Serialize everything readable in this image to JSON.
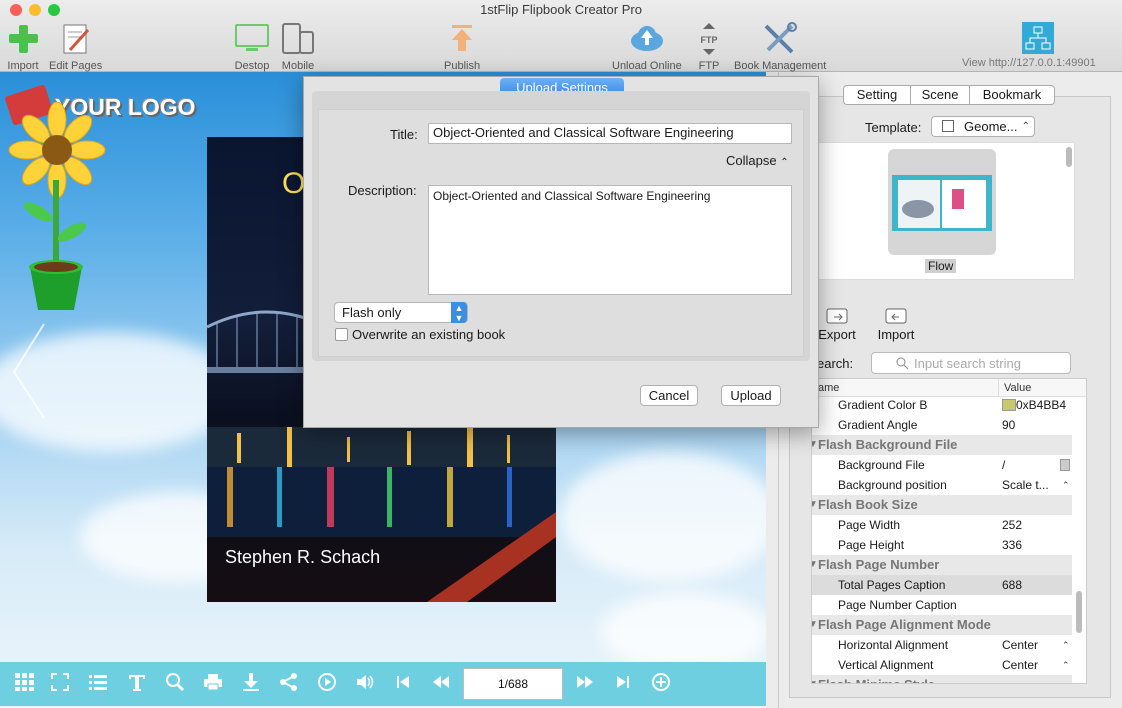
{
  "window": {
    "title": "1stFlip Flipbook Creator Pro"
  },
  "toolbar": {
    "import": "Import",
    "edit_pages": "Edit Pages",
    "desktop": "Destop",
    "mobile": "Mobile",
    "publish": "Publish",
    "upload_online": "Unload Online",
    "ftp": "FTP",
    "ftp_badge": "FTP",
    "book_management": "Book Management",
    "view_url": "View http://127.0.0.1:49901"
  },
  "preview": {
    "logo_text": "YOUR LOGO",
    "book_author": "Stephen R. Schach",
    "book_title_fragment": "O"
  },
  "bottom_bar": {
    "page_indicator": "1/688"
  },
  "dialog": {
    "title": "Upload Settings",
    "title_label": "Title:",
    "title_value": "Object-Oriented and Classical Software Engineering",
    "collapse_label": "Collapse",
    "description_label": "Description:",
    "description_value": "Object-Oriented and Classical Software Engineering",
    "format_select": "Flash only",
    "overwrite_label": "Overwrite an existing book",
    "cancel": "Cancel",
    "upload": "Upload"
  },
  "right_panel": {
    "tabs": [
      "Setting",
      "Scene",
      "Bookmark"
    ],
    "template_label": "Template:",
    "template_value": "Geome...",
    "template_thumb_label": "Flow",
    "export": "Export",
    "import": "Import",
    "search_label": "earch:",
    "search_placeholder": "Input search string",
    "col_name": "ame",
    "col_value": "Value",
    "rows": [
      {
        "type": "prop",
        "name": "Gradient Color B",
        "value": "0xB4BB4"
      },
      {
        "type": "prop",
        "name": "Gradient Angle",
        "value": "90"
      },
      {
        "type": "cat",
        "name": "Flash Background File",
        "value": ""
      },
      {
        "type": "prop",
        "name": "Background File",
        "value": "/"
      },
      {
        "type": "prop",
        "name": "Background position",
        "value": "Scale t..."
      },
      {
        "type": "cat",
        "name": "Flash Book Size",
        "value": ""
      },
      {
        "type": "prop",
        "name": "Page Width",
        "value": "252"
      },
      {
        "type": "prop",
        "name": "Page Height",
        "value": "336"
      },
      {
        "type": "cat",
        "name": "Flash Page Number",
        "value": ""
      },
      {
        "type": "prop",
        "name": "Total Pages Caption",
        "value": "688"
      },
      {
        "type": "prop",
        "name": "Page Number Caption",
        "value": ""
      },
      {
        "type": "cat",
        "name": "Flash Page Alignment  Mode",
        "value": ""
      },
      {
        "type": "prop",
        "name": "Horizontal Alignment",
        "value": "Center"
      },
      {
        "type": "prop",
        "name": "Vertical Alignment",
        "value": "Center"
      },
      {
        "type": "cat",
        "name": "Flash Minime Style",
        "value": ""
      }
    ]
  },
  "colors": {
    "accent": "#3a8ee6",
    "bottom_bar": "#6dcfe0",
    "gradient_swatch": "#c8c870"
  }
}
